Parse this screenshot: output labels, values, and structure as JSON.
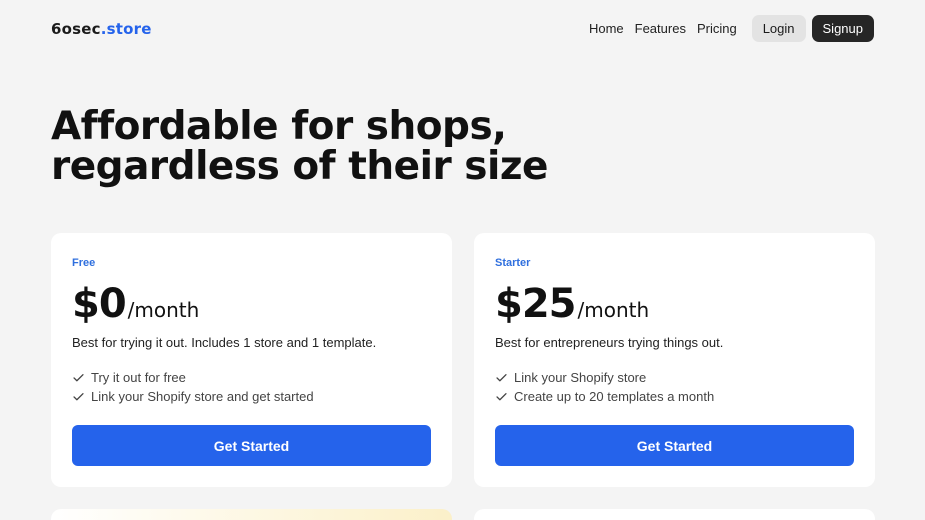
{
  "header": {
    "logo_main": "6osec",
    "logo_accent": ".store",
    "nav": [
      {
        "label": "Home"
      },
      {
        "label": "Features"
      },
      {
        "label": "Pricing"
      }
    ],
    "login_label": "Login",
    "signup_label": "Signup"
  },
  "hero": {
    "line1": "Affordable for shops,",
    "line2": "regardless of their size"
  },
  "plans": [
    {
      "name": "Free",
      "price": "$0",
      "period": "/month",
      "description": "Best for trying it out. Includes 1 store and 1 template.",
      "features": [
        "Try it out for free",
        "Link your Shopify store and get started"
      ],
      "cta": "Get Started"
    },
    {
      "name": "Starter",
      "price": "$25",
      "period": "/month",
      "description": "Best for entrepreneurs trying things out.",
      "features": [
        "Link your Shopify store",
        "Create up to 20 templates a month"
      ],
      "cta": "Get Started"
    }
  ],
  "colors": {
    "accent": "#2563eb",
    "background": "#f4f4f4",
    "dark_button": "#262626"
  }
}
